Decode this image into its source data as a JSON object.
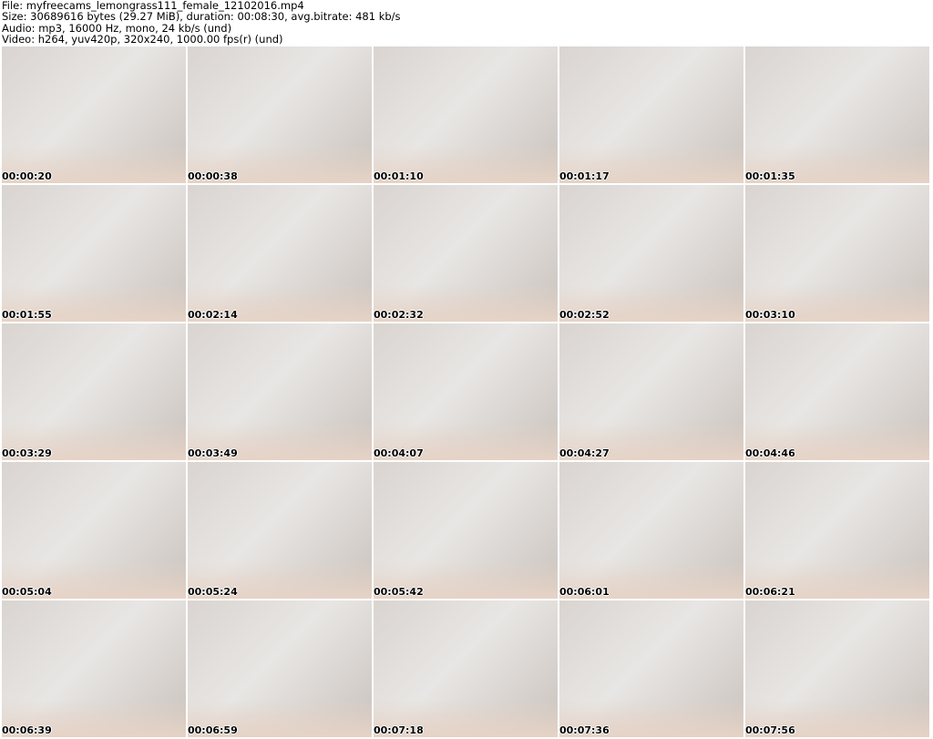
{
  "header": {
    "file": "File: myfreecams_lemongrass111_female_12102016.mp4",
    "size": "Size: 30689616 bytes (29.27 MiB), duration: 00:08:30, avg.bitrate: 481 kb/s",
    "audio": "Audio: mp3, 16000 Hz, mono, 24 kb/s (und)",
    "video": "Video: h264, yuv420p, 320x240, 1000.00 fps(r) (und)"
  },
  "thumbnails": [
    "00:00:20",
    "00:00:38",
    "00:01:10",
    "00:01:17",
    "00:01:35",
    "00:01:55",
    "00:02:14",
    "00:02:32",
    "00:02:52",
    "00:03:10",
    "00:03:29",
    "00:03:49",
    "00:04:07",
    "00:04:27",
    "00:04:46",
    "00:05:04",
    "00:05:24",
    "00:05:42",
    "00:06:01",
    "00:06:21",
    "00:06:39",
    "00:06:59",
    "00:07:18",
    "00:07:36",
    "00:07:56"
  ]
}
